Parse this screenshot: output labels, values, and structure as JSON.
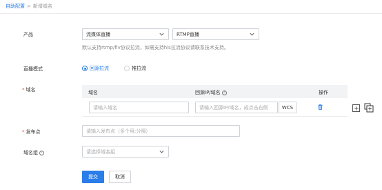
{
  "breadcrumb": {
    "parent": "自助配置",
    "separator": ">",
    "current": "新增域名"
  },
  "product": {
    "label": "产品",
    "select1": "流媒体直播",
    "select2": "RTMP直播",
    "hint": "默认支持rtmp/flv协议拉流，如需支持hls拉流协议请联系技术支持。"
  },
  "mode": {
    "label": "直播模式",
    "options": [
      {
        "label": "回源拉流",
        "selected": true
      },
      {
        "label": "推拉流",
        "selected": false
      }
    ]
  },
  "domain": {
    "label": "域名",
    "columns": {
      "domain": "域名",
      "origin": "回源IP/域名",
      "action": "操作"
    },
    "row": {
      "domain_placeholder": "请输入域名",
      "origin_placeholder": "请输入回源IP/域名，成点击右侧",
      "wcs_label": "WCS"
    },
    "icons": {
      "delete": "trash-icon",
      "add": "plus-icon",
      "copy": "copy-icon"
    }
  },
  "publish": {
    "label": "发布点",
    "placeholder": "请输入发布点（多个用;分隔）"
  },
  "group": {
    "label": "域名组",
    "placeholder": "请选择域名组"
  },
  "actions": {
    "submit": "提交",
    "cancel": "取消"
  },
  "colors": {
    "accent": "#2b7de9",
    "required": "#e53935"
  }
}
